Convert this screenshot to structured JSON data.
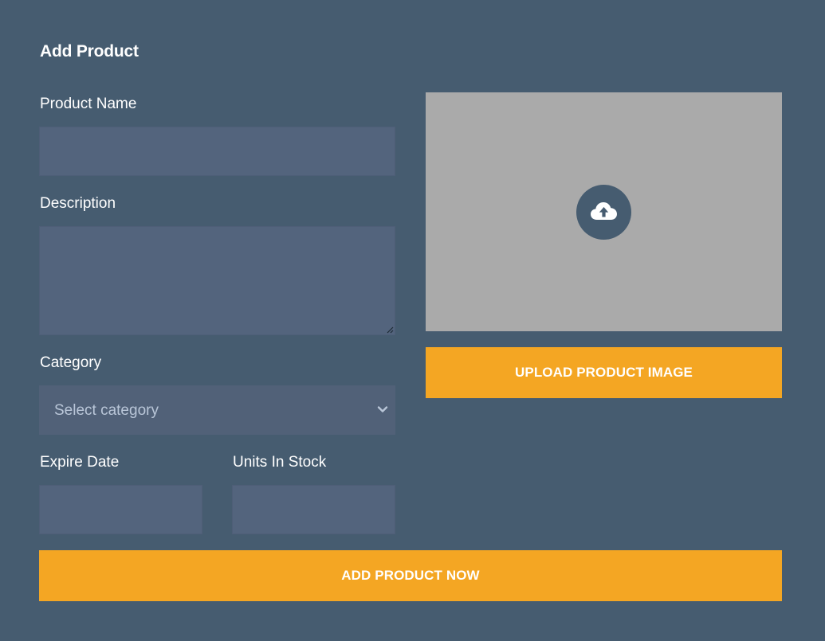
{
  "form": {
    "title": "Add Product",
    "product_name": {
      "label": "Product Name",
      "value": "",
      "placeholder": ""
    },
    "description": {
      "label": "Description",
      "value": "",
      "placeholder": ""
    },
    "category": {
      "label": "Category",
      "selected": "Select category"
    },
    "expire_date": {
      "label": "Expire Date",
      "value": "",
      "placeholder": ""
    },
    "units_in_stock": {
      "label": "Units In Stock",
      "value": "",
      "placeholder": ""
    },
    "image_upload": {
      "icon": "cloud-upload-icon",
      "button_label": "UPLOAD PRODUCT IMAGE"
    },
    "submit_label": "ADD PRODUCT NOW"
  },
  "colors": {
    "background": "#465c70",
    "input_fill": "#53647d",
    "image_placeholder": "#aaaaaa",
    "accent": "#f4a623",
    "select_text": "#b9c6d8"
  }
}
